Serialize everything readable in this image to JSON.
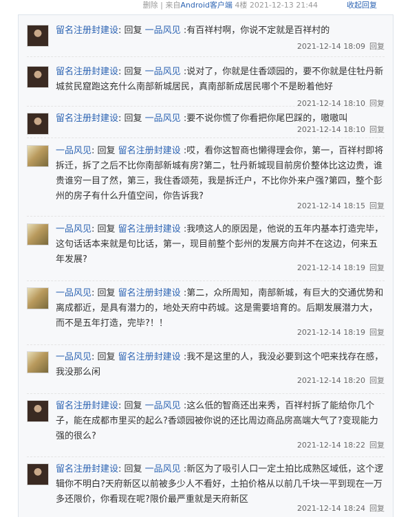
{
  "header": {
    "meta": "删除 | 来自Android客户端   4楼   2021-12-13 21:44",
    "meta_parts": [
      "删除 | 来自",
      "Android客户端",
      "   4楼   2021-12-13 21:44"
    ],
    "collapse_label": "收起回复"
  },
  "replies": [
    {
      "user": "留名注册封建设",
      "verb": ": 回复 ",
      "target": "一品风见",
      "content": " :有百祥村啊，你说不定就是百祥村的",
      "time": "2021-12-14 18:09",
      "reply_label": "回复",
      "avatar": "dark"
    },
    {
      "user": "留名注册封建设",
      "verb": ": 回复 ",
      "target": "一品风见",
      "content": " :说对了，你就是住香颂园的，要不你就是住牡丹新城贫民窟跑这充什么南部新城居民，真南部新成居民哪个不是盼着他好",
      "time": "2021-12-14 18:10",
      "reply_label": "回复",
      "avatar": "dark"
    },
    {
      "user": "留名注册封建设",
      "verb": ": 回复 ",
      "target": "一品风见",
      "content": " :要不说你慌了你看把你尾巴踩的，嗷嗷叫",
      "time": "2021-12-14 18:10",
      "reply_label": "回复",
      "avatar": "dark"
    },
    {
      "user": "一品风见",
      "verb": ": 回复 ",
      "target": "留名注册封建设",
      "content": " :哎，看你这智商也懒得理会你，第一，百祥村即将拆迁，拆了之后不比你南部新城有房?第二，牡丹新城现目前房价整体比这边贵，谁贵谁穷一目了然，第三，我住香颂苑，我是拆迁户，不比你外来户强?第四，整个彭州的房子有什么升值空间，你告诉我?",
      "time": "2021-12-14 18:15",
      "reply_label": "回复",
      "avatar": "light"
    },
    {
      "user": "一品风见",
      "verb": ": 回复 ",
      "target": "留名注册封建设",
      "content": " :我喷这人的原因是，他说的五年内基本打造完毕，这句话话本来就是句比话，第一，现目前整个彭州的发展方向并不在这边，何来五年发展?",
      "time": "2021-12-14 18:19",
      "reply_label": "回复",
      "avatar": "light"
    },
    {
      "user": "一品风见",
      "verb": ": 回复 ",
      "target": "留名注册封建设",
      "content": " :第二，众所周知，南部新城，有巨大的交通优势和离成都近，是具有潜力的，地处天府中药城。这是需要培育的。后期发展潜力大，而不是五年打造，完毕?！！",
      "time": "2021-12-14 18:19",
      "reply_label": "回复",
      "avatar": "light"
    },
    {
      "user": "一品风见",
      "verb": ": 回复 ",
      "target": "留名注册封建设",
      "content": " :我不是这里的人，我没必要到这个吧来找存在感，我没那么闲",
      "time": "2021-12-14 18:20",
      "reply_label": "回复",
      "avatar": "light"
    },
    {
      "user": "留名注册封建设",
      "verb": ": 回复 ",
      "target": "一品风见",
      "content": " :这么低的智商还出来秀，百祥村拆了能给你几个子，能在成都市里买的起么?香颂园被你说的还比周边商品房高端大气了?变现能力强的很么?",
      "time": "2021-12-14 18:22",
      "reply_label": "回复",
      "avatar": "dark"
    },
    {
      "user": "留名注册封建设",
      "verb": ": 回复 ",
      "target": "一品风见",
      "content": " :新区为了吸引人口一定土拍比成熟区域低，这个逻辑你不明白?天府新区以前被多少人不看好，土拍价格从以前几千块一平到现在一万多还限价，你看现在呢?限价最严重就是天府新区",
      "time": "2021-12-14 18:24",
      "reply_label": "回复",
      "avatar": "dark"
    }
  ]
}
